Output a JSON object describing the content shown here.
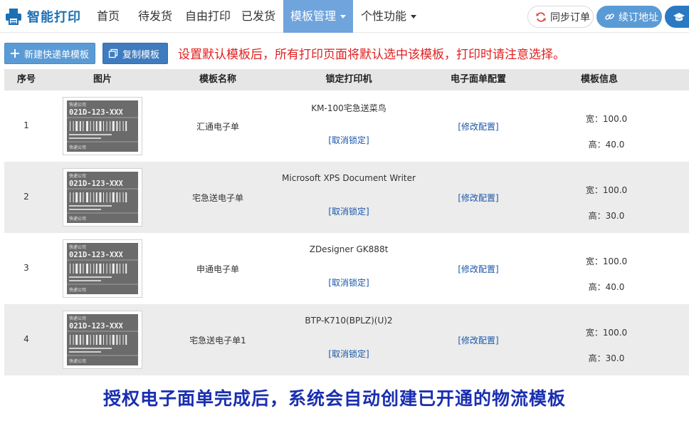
{
  "brand": {
    "title": "智能打印",
    "icon": "printer-icon",
    "color": "#1a6fb5"
  },
  "nav": {
    "items": [
      {
        "label": "首页"
      },
      {
        "label": "待发货"
      },
      {
        "label": "自由打印"
      },
      {
        "label": "已发货"
      },
      {
        "label": "模板管理",
        "active": true,
        "dropdown": true
      },
      {
        "label": "个性功能",
        "dropdown": true
      }
    ],
    "active_color": "#6fa4dc"
  },
  "header_buttons": {
    "sync": {
      "label": "同步订单",
      "icon": "refresh-icon"
    },
    "renew": {
      "label": "续订地址",
      "icon": "link-icon"
    },
    "education": {
      "icon": "graduation-cap-icon"
    }
  },
  "toolbar": {
    "new_label": "新建快递单模板",
    "copy_label": "复制模板",
    "notice": "设置默认模板后，所有打印页面将默认选中该模板，打印时请注意选择。"
  },
  "table": {
    "headers": [
      "序号",
      "图片",
      "模板名称",
      "锁定打印机",
      "电子面单配置",
      "模板信息"
    ],
    "rows": [
      {
        "no": "1",
        "name": "汇通电子单",
        "printer": "KM-100宅急送菜鸟",
        "unlock": "[取消锁定]",
        "config": "[修改配置]",
        "width": "宽：100.0",
        "height": "高：40.0"
      },
      {
        "no": "2",
        "name": "宅急送电子单",
        "printer": "Microsoft XPS Document Writer",
        "unlock": "[取消锁定]",
        "config": "[修改配置]",
        "width": "宽：100.0",
        "height": "高：30.0"
      },
      {
        "no": "3",
        "name": "申通电子单",
        "printer": "ZDesigner GK888t",
        "unlock": "[取消锁定]",
        "config": "[修改配置]",
        "width": "宽：100.0",
        "height": "高：40.0"
      },
      {
        "no": "4",
        "name": "宅急送电子单1",
        "printer": "BTP-K710(BPLZ)(U)2",
        "unlock": "[取消锁定]",
        "config": "[修改配置]",
        "width": "宽：100.0",
        "height": "高：30.0"
      }
    ],
    "thumb": {
      "company": "快递公司",
      "code": "021D-123-XXX",
      "footer": "快递公司"
    }
  },
  "caption": "授权电子面单完成后，系统会自动创建已开通的物流模板"
}
